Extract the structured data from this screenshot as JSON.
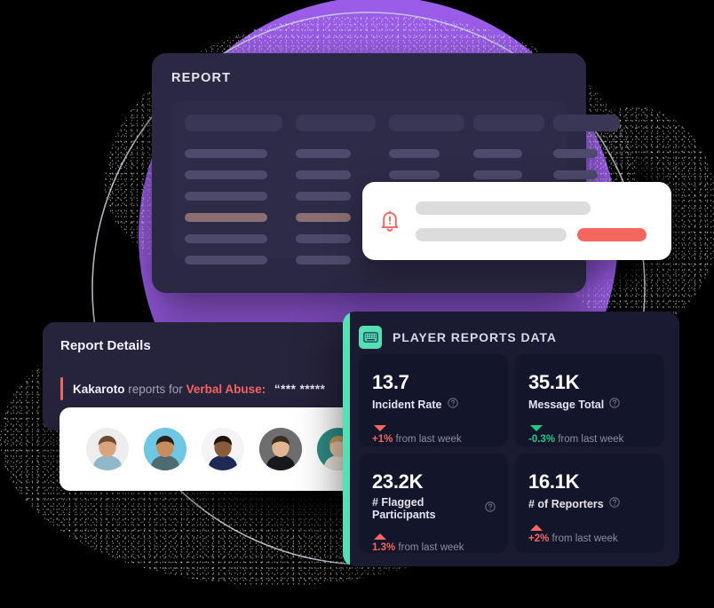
{
  "report_panel": {
    "title": "REPORT",
    "skeleton": {
      "columns": 5,
      "rows_per_column": 6,
      "highlighted_row_index": 3,
      "head_color": "#3A3655",
      "row_color": "#4D4A6B",
      "highlight_color": "#8A6E72"
    }
  },
  "toast": {
    "icon": "bell-alert-icon",
    "accent_color": "#F4675F"
  },
  "report_details": {
    "title": "Report Details",
    "accent_color": "#F4675F",
    "quote": {
      "reporter": "Kakaroto",
      "connector": "reports for",
      "reason": "Verbal Abuse:",
      "masked_message": "“*** *****"
    },
    "avatars": [
      {
        "name": "avatar-1",
        "bg": "#EDEDEF",
        "skin": "#D9A57E",
        "hair": "#6E4B32",
        "shirt": "#8FB9C9"
      },
      {
        "name": "avatar-2",
        "bg": "#6FC7E4",
        "skin": "#C98C5E",
        "hair": "#2B2119",
        "shirt": "#4F6B72"
      },
      {
        "name": "avatar-3",
        "bg": "#F4F4F5",
        "skin": "#8A5A3B",
        "hair": "#1E1410",
        "shirt": "#1E2A55"
      },
      {
        "name": "avatar-4",
        "bg": "#6E6E70",
        "skin": "#E2B693",
        "hair": "#3B2A1E",
        "shirt": "#17181B"
      },
      {
        "name": "avatar-5",
        "bg": "#2E8C86",
        "skin": "#E8C4A4",
        "hair": "#C89A5B",
        "shirt": "#E7E3DA"
      }
    ]
  },
  "player_reports": {
    "title": "PLAYER REPORTS DATA",
    "icon": "keyboard-icon",
    "accent_color": "#55DFB5",
    "cards": [
      {
        "value": "13.7",
        "label": "Incident Rate",
        "help_icon": "help-circle-icon",
        "trend": "down",
        "delta": "+1%",
        "delta_color": "red",
        "delta_suffix": "from last week"
      },
      {
        "value": "35.1K",
        "label": "Message Total",
        "help_icon": "help-circle-icon",
        "trend": "down",
        "delta": "-0.3%",
        "delta_color": "green",
        "delta_suffix": "from last week"
      },
      {
        "value": "23.2K",
        "label": "# Flagged Participants",
        "help_icon": "help-circle-icon",
        "trend": "up",
        "delta": "1.3%",
        "delta_color": "red",
        "delta_suffix": "from last week"
      },
      {
        "value": "16.1K",
        "label": "# of Reporters",
        "help_icon": "help-circle-icon",
        "trend": "up",
        "delta": "+2%",
        "delta_color": "red",
        "delta_suffix": "from last week"
      }
    ]
  },
  "decor": {
    "circle_color": "#9B5DE8",
    "ring_color": "#D7DEE6"
  }
}
